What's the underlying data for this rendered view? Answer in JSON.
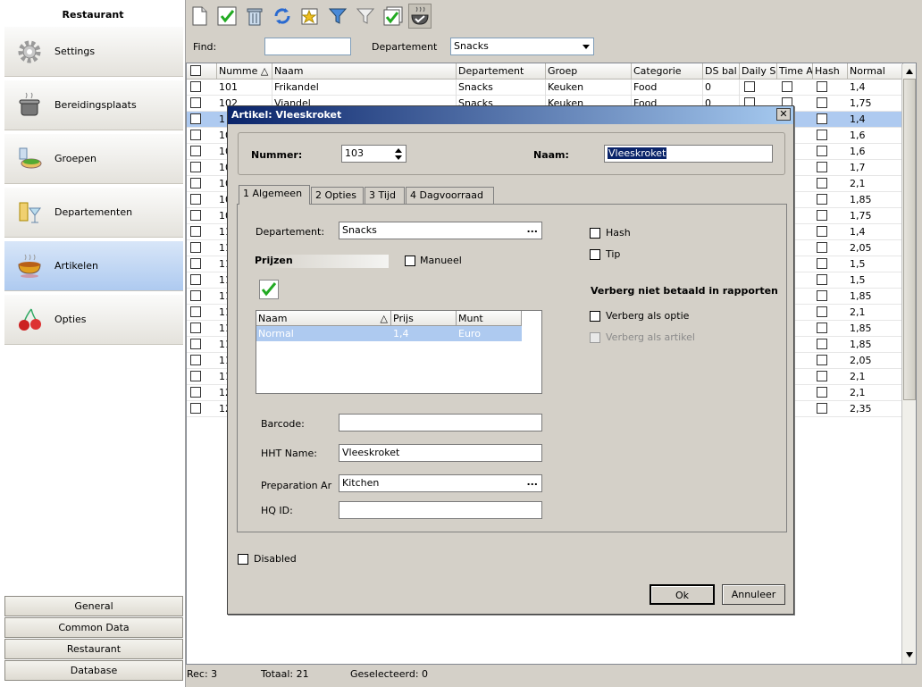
{
  "sidebar": {
    "title": "Restaurant",
    "items": [
      {
        "label": "Settings",
        "icon": "gear-icon"
      },
      {
        "label": "Bereidingsplaats",
        "icon": "cooking-pot-icon"
      },
      {
        "label": "Groepen",
        "icon": "food-bowl-icon"
      },
      {
        "label": "Departementen",
        "icon": "glasses-icon"
      },
      {
        "label": "Artikelen",
        "icon": "soup-bowl-icon"
      },
      {
        "label": "Opties",
        "icon": "cherries-icon"
      }
    ],
    "bottom": [
      "General",
      "Common Data",
      "Restaurant",
      "Database"
    ]
  },
  "toolbar": {
    "icons": [
      "new-document-icon",
      "check-icon",
      "delete-bin-icon",
      "refresh-icon",
      "favorite-icon",
      "filter-icon",
      "filter-off-icon",
      "check-all-icon",
      "cooking-icon"
    ]
  },
  "find": {
    "label": "Find:",
    "value": "",
    "dept_label": "Departement",
    "dept_value": "Snacks"
  },
  "grid": {
    "columns": [
      "Numme",
      "Naam",
      "Departement",
      "Groep",
      "Categorie",
      "DS bal",
      "Daily S",
      "Time A",
      "Hash",
      "Normal"
    ],
    "rows": [
      {
        "num": "101",
        "naam": "Frikandel",
        "dep": "Snacks",
        "groep": "Keuken",
        "cat": "Food",
        "ds": "0",
        "normal": "1,4"
      },
      {
        "num": "102",
        "naam": "Viandel",
        "dep": "Snacks",
        "groep": "Keuken",
        "cat": "Food",
        "ds": "0",
        "normal": "1,75"
      },
      {
        "num": "1",
        "normal": "1,4"
      },
      {
        "num": "10",
        "normal": "1,6"
      },
      {
        "num": "10",
        "normal": "1,6"
      },
      {
        "num": "10",
        "normal": "1,7"
      },
      {
        "num": "10",
        "normal": "2,1"
      },
      {
        "num": "10",
        "normal": "1,85"
      },
      {
        "num": "10",
        "normal": "1,75"
      },
      {
        "num": "11",
        "normal": "1,4"
      },
      {
        "num": "11",
        "normal": "2,05"
      },
      {
        "num": "11",
        "normal": "1,5"
      },
      {
        "num": "11",
        "normal": "1,5"
      },
      {
        "num": "11",
        "normal": "1,85"
      },
      {
        "num": "11",
        "normal": "2,1"
      },
      {
        "num": "11",
        "normal": "1,85"
      },
      {
        "num": "11",
        "normal": "1,85"
      },
      {
        "num": "11",
        "normal": "2,05"
      },
      {
        "num": "11",
        "normal": "2,1"
      },
      {
        "num": "12",
        "normal": "2,1"
      },
      {
        "num": "12",
        "normal": "2,35"
      }
    ]
  },
  "status": {
    "rec": "Rec: 3",
    "total": "Totaal: 21",
    "selected": "Geselecteerd: 0"
  },
  "dialog": {
    "title": "Artikel: Vleeskroket",
    "close": "✕",
    "nummer_label": "Nummer:",
    "nummer_value": "103",
    "naam_label": "Naam:",
    "naam_value": "Vleeskroket",
    "tabs": [
      "1 Algemeen",
      "2 Opties",
      "3 Tijd",
      "4 Dagvoorraad"
    ],
    "departement_label": "Departement:",
    "departement_value": "Snacks",
    "prijzen_label": "Prijzen",
    "manueel_label": "Manueel",
    "prices_columns": [
      "Naam",
      "Prijs",
      "Munt"
    ],
    "prices_row": {
      "naam": "Normal",
      "prijs": "1,4",
      "munt": "Euro"
    },
    "barcode_label": "Barcode:",
    "barcode_value": "",
    "hht_label": "HHT Name:",
    "hht_value": "Vleeskroket",
    "prep_label": "Preparation Ar",
    "prep_value": "Kitchen",
    "hq_label": "HQ ID:",
    "hq_value": "",
    "hash_label": "Hash",
    "tip_label": "Tip",
    "verberg_header": "Verberg niet betaald in rapporten",
    "verberg_optie": "Verberg als optie",
    "verberg_artikel": "Verberg als artikel",
    "disabled_label": "Disabled",
    "ok": "Ok",
    "annuleer": "Annuleer",
    "ellipsis": "..."
  }
}
